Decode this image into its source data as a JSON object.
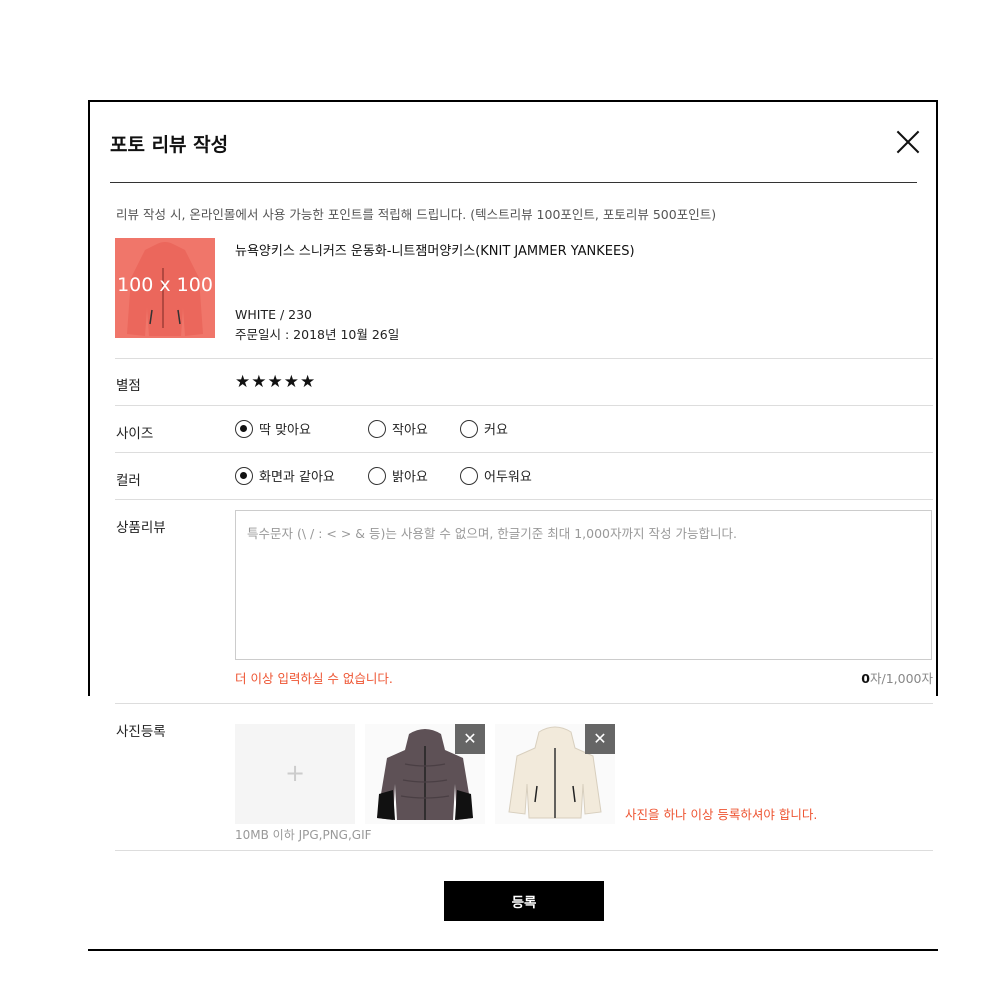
{
  "modal": {
    "title": "포토 리뷰 작성",
    "notice": "리뷰 작성 시, 온라인몰에서 사용 가능한 포인트를 적립해 드립니다. (텍스트리뷰 100포인트, 포토리뷰 500포인트)"
  },
  "product": {
    "thumb_text": "100 x 100",
    "name": "뉴욕양키스 스니커즈 운동화-니트잼머양키스(KNIT JAMMER YANKEES)",
    "option": "WHITE  /  230",
    "order_date": "주문일시 : 2018년 10월 26일"
  },
  "rating": {
    "label": "별점",
    "stars": "★★★★★",
    "value": 5,
    "max": 5
  },
  "size": {
    "label": "사이즈",
    "options": [
      "딱 맞아요",
      "작아요",
      "커요"
    ],
    "selected": 0
  },
  "color": {
    "label": "컬러",
    "options": [
      "화면과 같아요",
      "밝아요",
      "어두워요"
    ],
    "selected": 0
  },
  "review": {
    "label": "상품리뷰",
    "placeholder": "특수문자 (\\ / : < > & 등)는 사용할 수 없으며, 한글기준 최대 1,000자까지 작성 가능합니다.",
    "error": "더 이상 입력하실 수 없습니다.",
    "count": "0",
    "max": "자/1,000자"
  },
  "photos": {
    "label": "사진등록",
    "add_symbol": "+",
    "hint": "10MB 이하 JPG,PNG,GIF",
    "delete_symbol": "✕",
    "error": "사진을 하나 이상 등록하셔야 합니다."
  },
  "submit_label": "등록",
  "colors": {
    "accent_error": "#e53e2f",
    "button_bg": "#000000",
    "thumb_bg": "#f0766a"
  }
}
